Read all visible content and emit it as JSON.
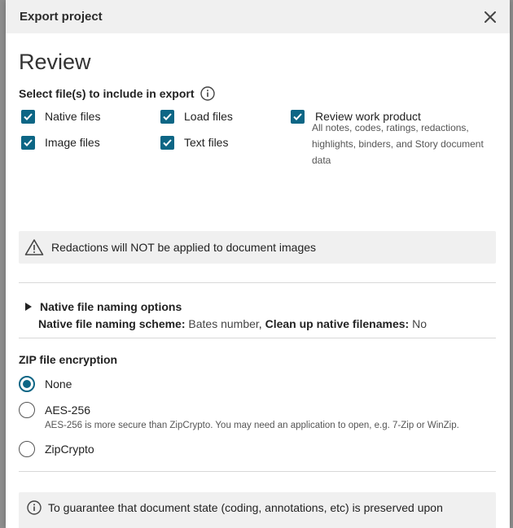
{
  "modal": {
    "title": "Export project",
    "close_icon": "close-icon"
  },
  "page": {
    "title": "Review"
  },
  "files": {
    "section_label": "Select file(s) to include in export",
    "info_icon": "info-icon",
    "options": [
      {
        "label": "Native files",
        "checked": true
      },
      {
        "label": "Load files",
        "checked": true
      },
      {
        "label": "Review work product",
        "checked": true
      },
      {
        "label": "Image files",
        "checked": true
      },
      {
        "label": "Text files",
        "checked": true
      }
    ],
    "work_product_description": "All notes, codes, ratings, redactions, highlights, binders, and Story document data"
  },
  "alert": {
    "icon": "warning-icon",
    "text": "Redactions will NOT be applied to document images"
  },
  "naming": {
    "toggle_label": "Native file naming options",
    "scheme_label": "Native file naming scheme:",
    "scheme_value": "Bates number",
    "separator": ",",
    "cleanup_label": "Clean up native filenames:",
    "cleanup_value": "No"
  },
  "encryption": {
    "title": "ZIP file encryption",
    "options": [
      {
        "label": "None",
        "selected": true
      },
      {
        "label": "AES-256",
        "selected": false
      },
      {
        "label": "ZipCrypto",
        "selected": false
      }
    ],
    "aes_help": "AES-256 is more secure than ZipCrypto. You may need an application to open, e.g. 7-Zip or WinZip."
  },
  "info_box": {
    "icon": "info-icon",
    "text": "To guarantee that document state (coding, annotations, etc) is preserved upon"
  },
  "colors": {
    "accent": "#0d6685",
    "header_bg": "#f0f0f0",
    "alert_bg": "#f0f0f0"
  }
}
